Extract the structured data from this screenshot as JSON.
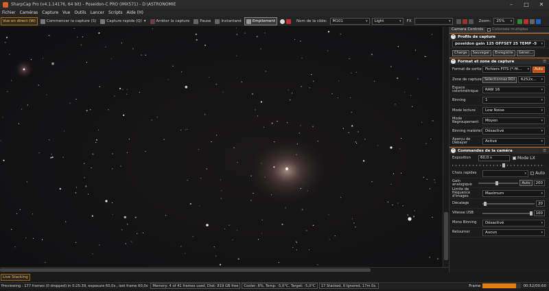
{
  "window": {
    "title": "SharpCap Pro (v4.1.14176, 64 bit) - Poseidon-C PRO (IMX571) - D:\\ASTRONOMIE"
  },
  "menu": [
    "Fichier",
    "Caméras",
    "Capture",
    "Vue",
    "Outils",
    "Lancer",
    "Scripts",
    "Aide (H)"
  ],
  "toolbar": {
    "live": "Vue en direct (W)",
    "start_capture": "Commencer la capture (S)",
    "quick_capture": "Capture rapide (Q)",
    "stop_capture": "Arrêter la capture",
    "pause": "Pause",
    "snapshot": "Instantané",
    "stacking": "Empilement",
    "target_label": "Nom de la cible:",
    "target_value": "M101",
    "frame_type": "Light",
    "fx_label": "FX",
    "zoom_label": "Zoom:",
    "zoom_value": "25%"
  },
  "panel": {
    "tabs": [
      "Camera Controls",
      "Colonnes multiples"
    ],
    "profiles": {
      "title": "Profils de capture",
      "value": "poseidon gain 125 OFFSET 25 TEMP -5",
      "buttons": [
        "Charge",
        "Sauvegar",
        "Enregistre",
        "Géner..."
      ]
    },
    "format": {
      "title": "Format et zone de capture",
      "rows": [
        {
          "label": "Format de sortie",
          "value": "Fichiers FITS (*.fit...",
          "extra": "Auto"
        },
        {
          "label": "Zone de capture",
          "value": "Sélectionnez ROI",
          "extra": "6252x..."
        },
        {
          "label": "Espace colorimétrique",
          "value": "RAW 16"
        },
        {
          "label": "Binning",
          "value": "1"
        },
        {
          "label": "Mode lecture",
          "value": "Low Noise"
        },
        {
          "label": "Mode Regroupement",
          "value": "Moyen"
        },
        {
          "label": "Binning matériel",
          "value": "Désactivé"
        },
        {
          "label": "Aperçu de Debayer",
          "value": "Activé"
        }
      ]
    },
    "camera": {
      "title": "Commandes de la caméra",
      "exposure_label": "Exposition",
      "exposure_value": "60,0 s",
      "mode_lx": "Mode LX",
      "quick_label": "Choix rapides",
      "auto": "Auto",
      "gain_label": "Gain analogique",
      "gain_value": "200",
      "gain_level": 0.45,
      "gain_auto": "Auto",
      "fps_label": "Limite de fréquence d'images",
      "fps_value": "Maximum",
      "offset_label": "Décalage",
      "offset_value": "20",
      "offset_level": 0.03,
      "usb_label": "Vitesse USB",
      "usb_value": "100",
      "usb_level": 1.0,
      "mono_label": "Mono Binning",
      "mono_value": "Désactivé",
      "flip_label": "Retourner",
      "flip_value": "Aucun"
    }
  },
  "status": {
    "live_tab": "Live Stacking",
    "preview": "Previewing : 177 frames (0 dropped) in 0:25:39, exposure 60,0s , last frame 60,0s",
    "memory": "Memory: 4 of 41 frames used, Disk: 819 GB free",
    "cooler": "Cooler: 8%, Temp: -5,0°C, Target: -5,0°C",
    "stacked": "17 Stacked, 0 Ignored, 17m 0s.",
    "frame_label": "Frame",
    "frame_time": "00:52/00:60",
    "frame_progress": 0.87
  },
  "colors": {
    "accent": "#d07020",
    "live": "#e08010"
  }
}
